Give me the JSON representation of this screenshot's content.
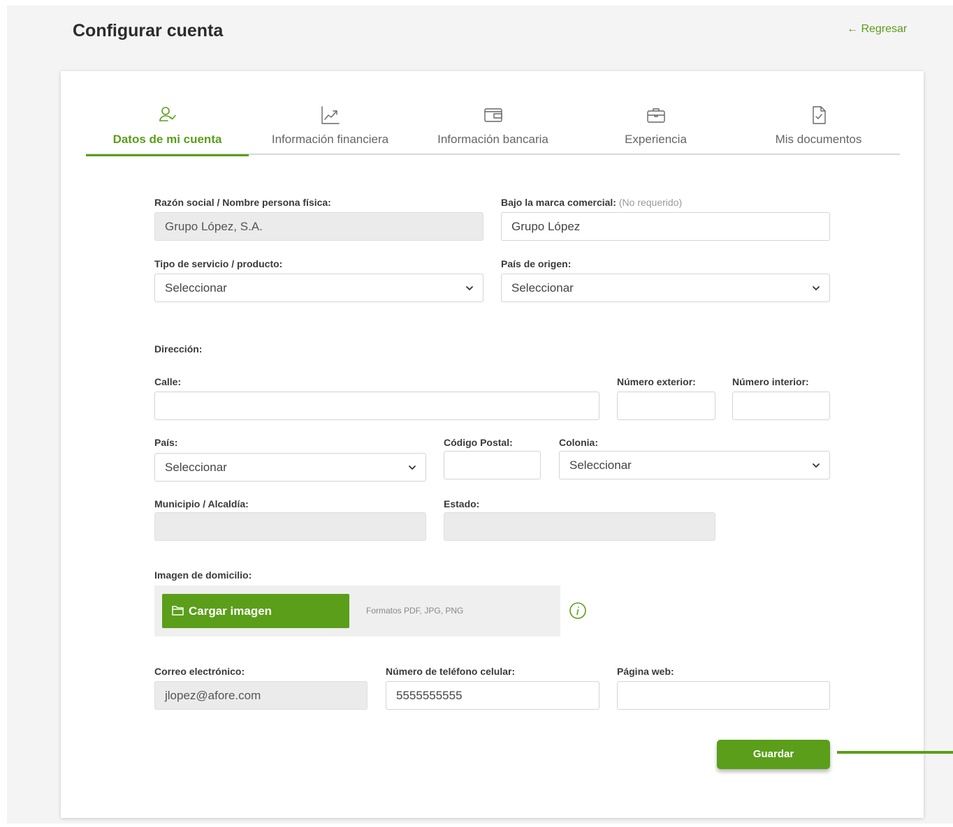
{
  "header": {
    "title": "Configurar cuenta",
    "back_link": "← Regresar"
  },
  "tabs": [
    {
      "label": "Datos de mi cuenta",
      "icon": "user-check-icon",
      "active": true
    },
    {
      "label": "Información financiera",
      "icon": "trend-chart-icon",
      "active": false
    },
    {
      "label": "Información bancaria",
      "icon": "wallet-icon",
      "active": false
    },
    {
      "label": "Experiencia",
      "icon": "briefcase-icon",
      "active": false
    },
    {
      "label": "Mis documentos",
      "icon": "document-check-icon",
      "active": false
    }
  ],
  "form": {
    "razon_social": {
      "label": "Razón social / Nombre persona física:",
      "value": "Grupo López, S.A."
    },
    "marca_comercial": {
      "label": "Bajo la marca comercial:",
      "note": "(No requerido)",
      "value": "Grupo López"
    },
    "tipo_servicio": {
      "label": "Tipo de servicio / producto:",
      "value": "Seleccionar"
    },
    "pais_origen": {
      "label": "País de origen:",
      "value": "Seleccionar"
    },
    "direccion_label": "Dirección:",
    "calle": {
      "label": "Calle:",
      "value": ""
    },
    "numero_exterior": {
      "label": "Número exterior:",
      "value": ""
    },
    "numero_interior": {
      "label": "Número interior:",
      "value": ""
    },
    "pais": {
      "label": "País:",
      "value": "Seleccionar"
    },
    "codigo_postal": {
      "label": "Código Postal:",
      "value": ""
    },
    "colonia": {
      "label": "Colonia:",
      "value": "Seleccionar"
    },
    "municipio": {
      "label": "Municipio / Alcaldía:",
      "value": ""
    },
    "estado": {
      "label": "Estado:",
      "value": ""
    },
    "imagen_domicilio": {
      "label": "Imagen de domicilio:",
      "button": "Cargar imagen",
      "formats": "Formatos PDF, JPG, PNG"
    },
    "correo": {
      "label": "Correo electrónico:",
      "value": "jlopez@afore.com"
    },
    "telefono": {
      "label": "Número de teléfono celular:",
      "value": "5555555555"
    },
    "pagina_web": {
      "label": "Página web:",
      "value": ""
    }
  },
  "actions": {
    "save": "Guardar"
  },
  "colors": {
    "accent": "#5a9e1a",
    "disabled_bg": "#ebebeb",
    "page_bg": "#f4f4f4"
  }
}
